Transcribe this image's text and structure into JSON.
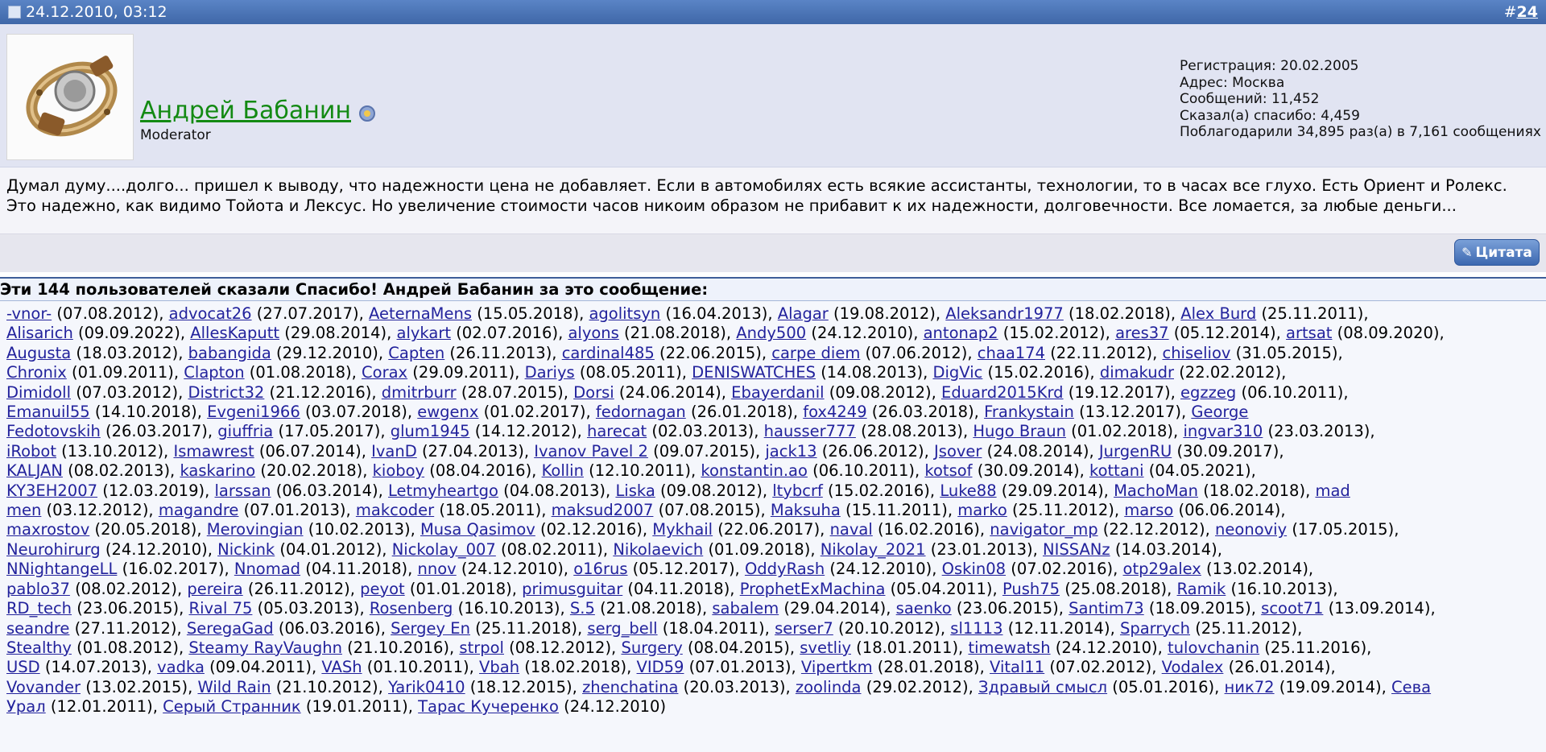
{
  "post": {
    "date": "24.12.2010, 03:12",
    "hash": "#",
    "number": "24",
    "author": "Андрей Бабанин",
    "title": "Moderator",
    "info": [
      "Регистрация: 20.02.2005",
      "Адрес: Москва",
      "Сообщений: 11,452",
      "Сказал(а) спасибо: 4,459",
      "Поблагодарили 34,895 раз(а) в 7,161 сообщениях"
    ],
    "message_lines": [
      "Думал думу....долго... пришел к выводу, что надежности цена не добавляет. Если в автомобилях есть всякие ассистанты, технологии, то в часах все глухо. Есть Ориент и Ролекс.",
      "Это надежно, как видимо Тойота и Лексус. Но увеличение стоимости часов никоим образом не прибавит к их надежности, долговечности. Все ломается, за любые деньги..."
    ],
    "quote_label": "Цитата"
  },
  "thanks": {
    "heading": "Эти 144 пользователей сказали Спасибо! Андрей Бабанин за это сообщение:",
    "lines": [
      [
        [
          "-vnor-",
          "07.08.2012"
        ],
        [
          "advocat26",
          "27.07.2017"
        ],
        [
          "AeternaMens",
          "15.05.2018"
        ],
        [
          "agolitsyn",
          "16.04.2013"
        ],
        [
          "Alagar",
          "19.08.2012"
        ],
        [
          "Aleksandr1977",
          "18.02.2018"
        ],
        [
          "Alex Burd",
          "25.11.2011"
        ]
      ],
      [
        [
          "Alisarich",
          "09.09.2022"
        ],
        [
          "AllesKaputt",
          "29.08.2014"
        ],
        [
          "alykart",
          "02.07.2016"
        ],
        [
          "alyons",
          "21.08.2018"
        ],
        [
          "Andy500",
          "24.12.2010"
        ],
        [
          "antonap2",
          "15.02.2012"
        ],
        [
          "ares37",
          "05.12.2014"
        ],
        [
          "artsat",
          "08.09.2020"
        ]
      ],
      [
        [
          "Augusta",
          "18.03.2012"
        ],
        [
          "babangida",
          "29.12.2010"
        ],
        [
          "Capten",
          "26.11.2013"
        ],
        [
          "cardinal485",
          "22.06.2015"
        ],
        [
          "carpe diem",
          "07.06.2012"
        ],
        [
          "chaa174",
          "22.11.2012"
        ],
        [
          "chiseliov",
          "31.05.2015"
        ]
      ],
      [
        [
          "Chronix",
          "01.09.2011"
        ],
        [
          "Clapton",
          "01.08.2018"
        ],
        [
          "Corax",
          "29.09.2011"
        ],
        [
          "Dariys",
          "08.05.2011"
        ],
        [
          "DENISWATCHES",
          "14.08.2013"
        ],
        [
          "DigVic",
          "15.02.2016"
        ],
        [
          "dimakudr",
          "22.02.2012"
        ]
      ],
      [
        [
          "Dimidoll",
          "07.03.2012"
        ],
        [
          "District32",
          "21.12.2016"
        ],
        [
          "dmitrburr",
          "28.07.2015"
        ],
        [
          "Dorsi",
          "24.06.2014"
        ],
        [
          "Ebayerdanil",
          "09.08.2012"
        ],
        [
          "Eduard2015Krd",
          "19.12.2017"
        ],
        [
          "egzzeg",
          "06.10.2011"
        ]
      ],
      [
        [
          "Emanuil55",
          "14.10.2018"
        ],
        [
          "Evgeni1966",
          "03.07.2018"
        ],
        [
          "ewgenx",
          "01.02.2017"
        ],
        [
          "fedornagan",
          "26.01.2018"
        ],
        [
          "fox4249",
          "26.03.2018"
        ],
        [
          "Frankystain",
          "13.12.2017"
        ],
        [
          "George",
          ""
        ]
      ],
      [
        [
          "Fedotovskih",
          "26.03.2017"
        ],
        [
          "giuffria",
          "17.05.2017"
        ],
        [
          "glum1945",
          "14.12.2012"
        ],
        [
          "harecat",
          "02.03.2013"
        ],
        [
          "hausser777",
          "28.08.2013"
        ],
        [
          "Hugo Braun",
          "01.02.2018"
        ],
        [
          "ingvar310",
          "23.03.2013"
        ]
      ],
      [
        [
          "iRobot",
          "13.10.2012"
        ],
        [
          "Ismawrest",
          "06.07.2014"
        ],
        [
          "IvanD",
          "27.04.2013"
        ],
        [
          "Ivanov Pavel 2",
          "09.07.2015"
        ],
        [
          "jack13",
          "26.06.2012"
        ],
        [
          "Jsover",
          "24.08.2014"
        ],
        [
          "JurgenRU",
          "30.09.2017"
        ]
      ],
      [
        [
          "KALJAN",
          "08.02.2013"
        ],
        [
          "kaskarino",
          "20.02.2018"
        ],
        [
          "kioboy",
          "08.04.2016"
        ],
        [
          "Kollin",
          "12.10.2011"
        ],
        [
          "konstantin.ao",
          "06.10.2011"
        ],
        [
          "kotsof",
          "30.09.2014"
        ],
        [
          "kottani",
          "04.05.2021"
        ]
      ],
      [
        [
          "KY3EH2007",
          "12.03.2019"
        ],
        [
          "larssan",
          "06.03.2014"
        ],
        [
          "Letmyheartgo",
          "04.08.2013"
        ],
        [
          "Liska",
          "09.08.2012"
        ],
        [
          "ltybcrf",
          "15.02.2016"
        ],
        [
          "Luke88",
          "29.09.2014"
        ],
        [
          "MachoMan",
          "18.02.2018"
        ],
        [
          "mad",
          ""
        ]
      ],
      [
        [
          "men",
          "03.12.2012"
        ],
        [
          "magandre",
          "07.01.2013"
        ],
        [
          "makcoder",
          "18.05.2011"
        ],
        [
          "maksud2007",
          "07.08.2015"
        ],
        [
          "Maksuha",
          "15.11.2011"
        ],
        [
          "marko",
          "25.11.2012"
        ],
        [
          "marso",
          "06.06.2014"
        ]
      ],
      [
        [
          "maxrostov",
          "20.05.2018"
        ],
        [
          "Merovingian",
          "10.02.2013"
        ],
        [
          "Musa Qasimov",
          "02.12.2016"
        ],
        [
          "Mykhail",
          "22.06.2017"
        ],
        [
          "naval",
          "16.02.2016"
        ],
        [
          "navigator_mp",
          "22.12.2012"
        ],
        [
          "neonoviy",
          "17.05.2015"
        ]
      ],
      [
        [
          "Neurohirurg",
          "24.12.2010"
        ],
        [
          "Nickink",
          "04.01.2012"
        ],
        [
          "Nickolay_007",
          "08.02.2011"
        ],
        [
          "Nikolaevich",
          "01.09.2018"
        ],
        [
          "Nikolay_2021",
          "23.01.2013"
        ],
        [
          "NISSANz",
          "14.03.2014"
        ]
      ],
      [
        [
          "NNightangeLL",
          "16.02.2017"
        ],
        [
          "Nnomad",
          "04.11.2018"
        ],
        [
          "nnov",
          "24.12.2010"
        ],
        [
          "o16rus",
          "05.12.2017"
        ],
        [
          "OddyRash",
          "24.12.2010"
        ],
        [
          "Oskin08",
          "07.02.2016"
        ],
        [
          "otp29alex",
          "13.02.2014"
        ]
      ],
      [
        [
          "pablo37",
          "08.02.2012"
        ],
        [
          "pereira",
          "26.11.2012"
        ],
        [
          "peyot",
          "01.01.2018"
        ],
        [
          "primusguitar",
          "04.11.2018"
        ],
        [
          "ProphetExMachina",
          "05.04.2011"
        ],
        [
          "Push75",
          "25.08.2018"
        ],
        [
          "Ramik",
          "16.10.2013"
        ]
      ],
      [
        [
          "RD_tech",
          "23.06.2015"
        ],
        [
          "Rival 75",
          "05.03.2013"
        ],
        [
          "Rosenberg",
          "16.10.2013"
        ],
        [
          "S.5",
          "21.08.2018"
        ],
        [
          "sabalem",
          "29.04.2014"
        ],
        [
          "saenko",
          "23.06.2015"
        ],
        [
          "Santim73",
          "18.09.2015"
        ],
        [
          "scoot71",
          "13.09.2014"
        ]
      ],
      [
        [
          "seandre",
          "27.11.2012"
        ],
        [
          "SeregaGad",
          "06.03.2016"
        ],
        [
          "Sergey En",
          "25.11.2018"
        ],
        [
          "serg_bell",
          "18.04.2011"
        ],
        [
          "serser7",
          "20.10.2012"
        ],
        [
          "sl1113",
          "12.11.2014"
        ],
        [
          "Sparrych",
          "25.11.2012"
        ]
      ],
      [
        [
          "Stealthy",
          "01.08.2012"
        ],
        [
          "Steamy RayVaughn",
          "21.10.2016"
        ],
        [
          "strpol",
          "08.12.2012"
        ],
        [
          "Surgery",
          "08.04.2015"
        ],
        [
          "svetliy",
          "18.01.2011"
        ],
        [
          "timewatsh",
          "24.12.2010"
        ],
        [
          "tulovchanin",
          "25.11.2016"
        ]
      ],
      [
        [
          "USD",
          "14.07.2013"
        ],
        [
          "vadka",
          "09.04.2011"
        ],
        [
          "VASh",
          "01.10.2011"
        ],
        [
          "Vbah",
          "18.02.2018"
        ],
        [
          "VID59",
          "07.01.2013"
        ],
        [
          "Vipertkm",
          "28.01.2018"
        ],
        [
          "Vital11",
          "07.02.2012"
        ],
        [
          "Vodalex",
          "26.01.2014"
        ]
      ],
      [
        [
          "Vovander",
          "13.02.2015"
        ],
        [
          "Wild Rain",
          "21.10.2012"
        ],
        [
          "Yarik0410",
          "18.12.2015"
        ],
        [
          "zhenchatina",
          "20.03.2013"
        ],
        [
          "zoolinda",
          "29.02.2012"
        ],
        [
          "Здравый смысл",
          "05.01.2016"
        ],
        [
          "ник72",
          "19.09.2014"
        ],
        [
          "Сева",
          ""
        ]
      ],
      [
        [
          "Урал",
          "12.01.2011"
        ],
        [
          "Серый Странник",
          "19.01.2011"
        ],
        [
          "Тарас Кучеренко",
          "24.12.2010"
        ]
      ]
    ]
  }
}
